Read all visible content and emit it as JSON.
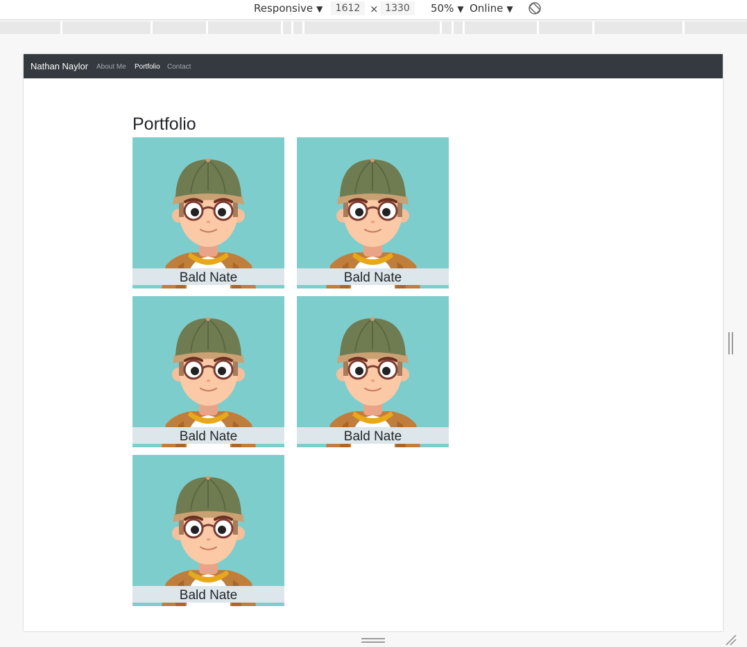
{
  "devtools": {
    "device": "Responsive",
    "width": "1612",
    "times": "×",
    "height": "1330",
    "zoom": "50%",
    "throttle": "Online",
    "rotate_icon": "rotate-icon"
  },
  "site": {
    "brand": "Nathan Naylor",
    "nav": [
      {
        "label": "About Me",
        "active": false
      },
      {
        "label": "Portfolio",
        "active": true
      },
      {
        "label": "Contact",
        "active": false
      }
    ],
    "page_title": "Portfolio",
    "cards": [
      {
        "caption": "Bald Nate"
      },
      {
        "caption": "Bald Nate"
      },
      {
        "caption": "Bald Nate"
      },
      {
        "caption": "Bald Nate"
      },
      {
        "caption": "Bald Nate"
      }
    ]
  },
  "colors": {
    "navbar": "#343a40",
    "card_bg": "#7ecdcd",
    "caption_bg": "#dde6ea"
  }
}
